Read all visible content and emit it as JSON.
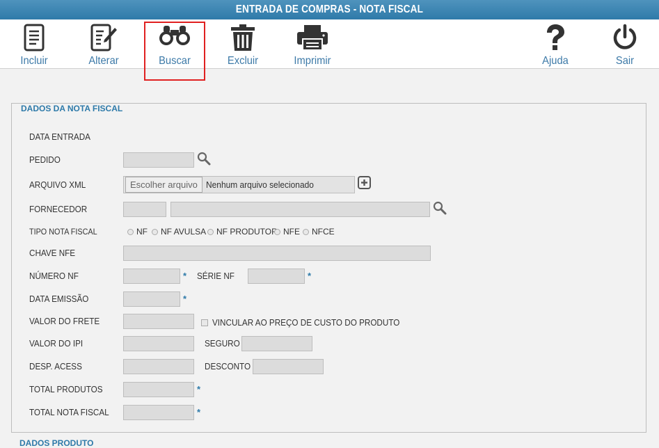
{
  "window": {
    "title": "ENTRADA DE COMPRAS - NOTA FISCAL"
  },
  "toolbar": {
    "incluir": "Incluir",
    "alterar": "Alterar",
    "buscar": "Buscar",
    "excluir": "Excluir",
    "imprimir": "Imprimir",
    "ajuda": "Ajuda",
    "sair": "Sair",
    "active": "buscar"
  },
  "section": {
    "title": "DADOS DA NOTA FISCAL",
    "next_title_partial": "DADOS PRODUTO"
  },
  "form": {
    "data_entrada": "DATA ENTRADA",
    "pedido": "PEDIDO",
    "arquivo_xml": "ARQUIVO XML",
    "file_button": "Escolher arquivo",
    "file_status": "Nenhum arquivo selecionado",
    "fornecedor": "FORNECEDOR",
    "tipo_nota_fiscal": "TIPO NOTA FISCAL",
    "tipo_options": [
      "NF",
      "NF AVULSA",
      "NF PRODUTOR",
      "NFE",
      "NFCE"
    ],
    "chave_nfe": "CHAVE NFE",
    "numero_nf": "NÚMERO NF",
    "serie_nf": "SÉRIE NF",
    "data_emissao": "DATA EMISSÃO",
    "valor_frete": "VALOR DO FRETE",
    "vincular": "VINCULAR AO PREÇO DE CUSTO DO PRODUTO",
    "valor_ipi": "VALOR DO IPI",
    "seguro": "SEGURO",
    "desp_acess": "DESP. ACESS",
    "desconto": "DESCONTO",
    "total_produtos": "TOTAL PRODUTOS",
    "total_nota_fiscal": "TOTAL NOTA FISCAL",
    "required_mark": "*"
  },
  "colors": {
    "accent": "#2e7aa9",
    "highlight": "#e02020"
  }
}
